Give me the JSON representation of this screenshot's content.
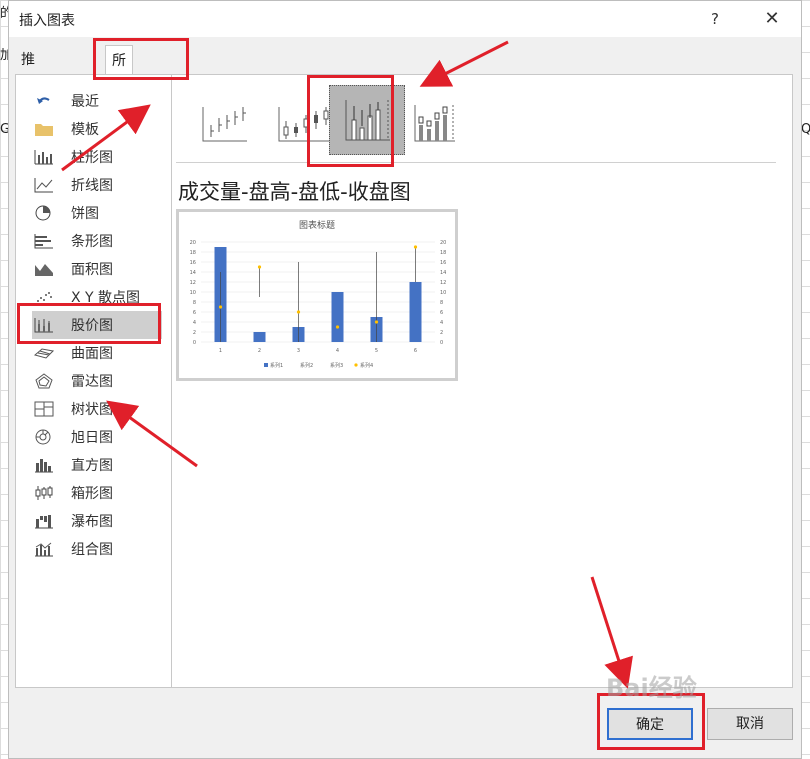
{
  "background": {
    "left_fragments": [
      "的",
      "加",
      "G"
    ],
    "right_fragment": "Q"
  },
  "dialog": {
    "title": "插入图表",
    "help_label": "?",
    "close_label": "✕"
  },
  "tabs": [
    {
      "label": "推荐的图表",
      "active": false
    },
    {
      "label": "所有图表",
      "active": true
    }
  ],
  "sidebar": {
    "items": [
      {
        "label": "最近",
        "icon": "undo-icon"
      },
      {
        "label": "模板",
        "icon": "folder-icon"
      },
      {
        "label": "柱形图",
        "icon": "column-chart-icon"
      },
      {
        "label": "折线图",
        "icon": "line-chart-icon"
      },
      {
        "label": "饼图",
        "icon": "pie-chart-icon"
      },
      {
        "label": "条形图",
        "icon": "bar-chart-icon"
      },
      {
        "label": "面积图",
        "icon": "area-chart-icon"
      },
      {
        "label": "X Y 散点图",
        "icon": "scatter-chart-icon"
      },
      {
        "label": "股价图",
        "icon": "stock-chart-icon",
        "selected": true
      },
      {
        "label": "曲面图",
        "icon": "surface-chart-icon"
      },
      {
        "label": "雷达图",
        "icon": "radar-chart-icon"
      },
      {
        "label": "树状图",
        "icon": "treemap-chart-icon"
      },
      {
        "label": "旭日图",
        "icon": "sunburst-chart-icon"
      },
      {
        "label": "直方图",
        "icon": "histogram-chart-icon"
      },
      {
        "label": "箱形图",
        "icon": "boxplot-chart-icon"
      },
      {
        "label": "瀑布图",
        "icon": "waterfall-chart-icon"
      },
      {
        "label": "组合图",
        "icon": "combo-chart-icon"
      }
    ]
  },
  "subtypes": [
    {
      "icon": "high-low-close-icon"
    },
    {
      "icon": "open-high-low-close-icon"
    },
    {
      "icon": "volume-high-low-close-icon",
      "selected": true
    },
    {
      "icon": "volume-open-high-low-close-icon"
    }
  ],
  "selected_chart_name": "成交量-盘高-盘低-收盘图",
  "chart_data": {
    "type": "bar",
    "title": "图表标题",
    "categories": [
      "1",
      "2",
      "3",
      "4",
      "5",
      "6"
    ],
    "ylim": [
      0,
      20
    ],
    "yticks": [
      "0",
      "2",
      "4",
      "6",
      "8",
      "10",
      "12",
      "14",
      "16",
      "18",
      "20"
    ],
    "series": [
      {
        "name": "系列1",
        "values": [
          19,
          2,
          3,
          10,
          5,
          12
        ],
        "color": "#4472c4"
      },
      {
        "name": "系列2",
        "values": [
          14,
          15,
          16,
          0,
          18,
          19
        ]
      },
      {
        "name": "系列3",
        "values": [
          0,
          9,
          0,
          0,
          0,
          12
        ]
      },
      {
        "name": "系列4",
        "values": [
          7,
          15,
          6,
          3,
          4,
          19
        ],
        "color": "#ffc000"
      }
    ],
    "legend_position": "bottom"
  },
  "footer": {
    "ok_label": "确定",
    "cancel_label": "取消"
  },
  "watermark": "Bai经验",
  "annotation_color": "#e0202a"
}
